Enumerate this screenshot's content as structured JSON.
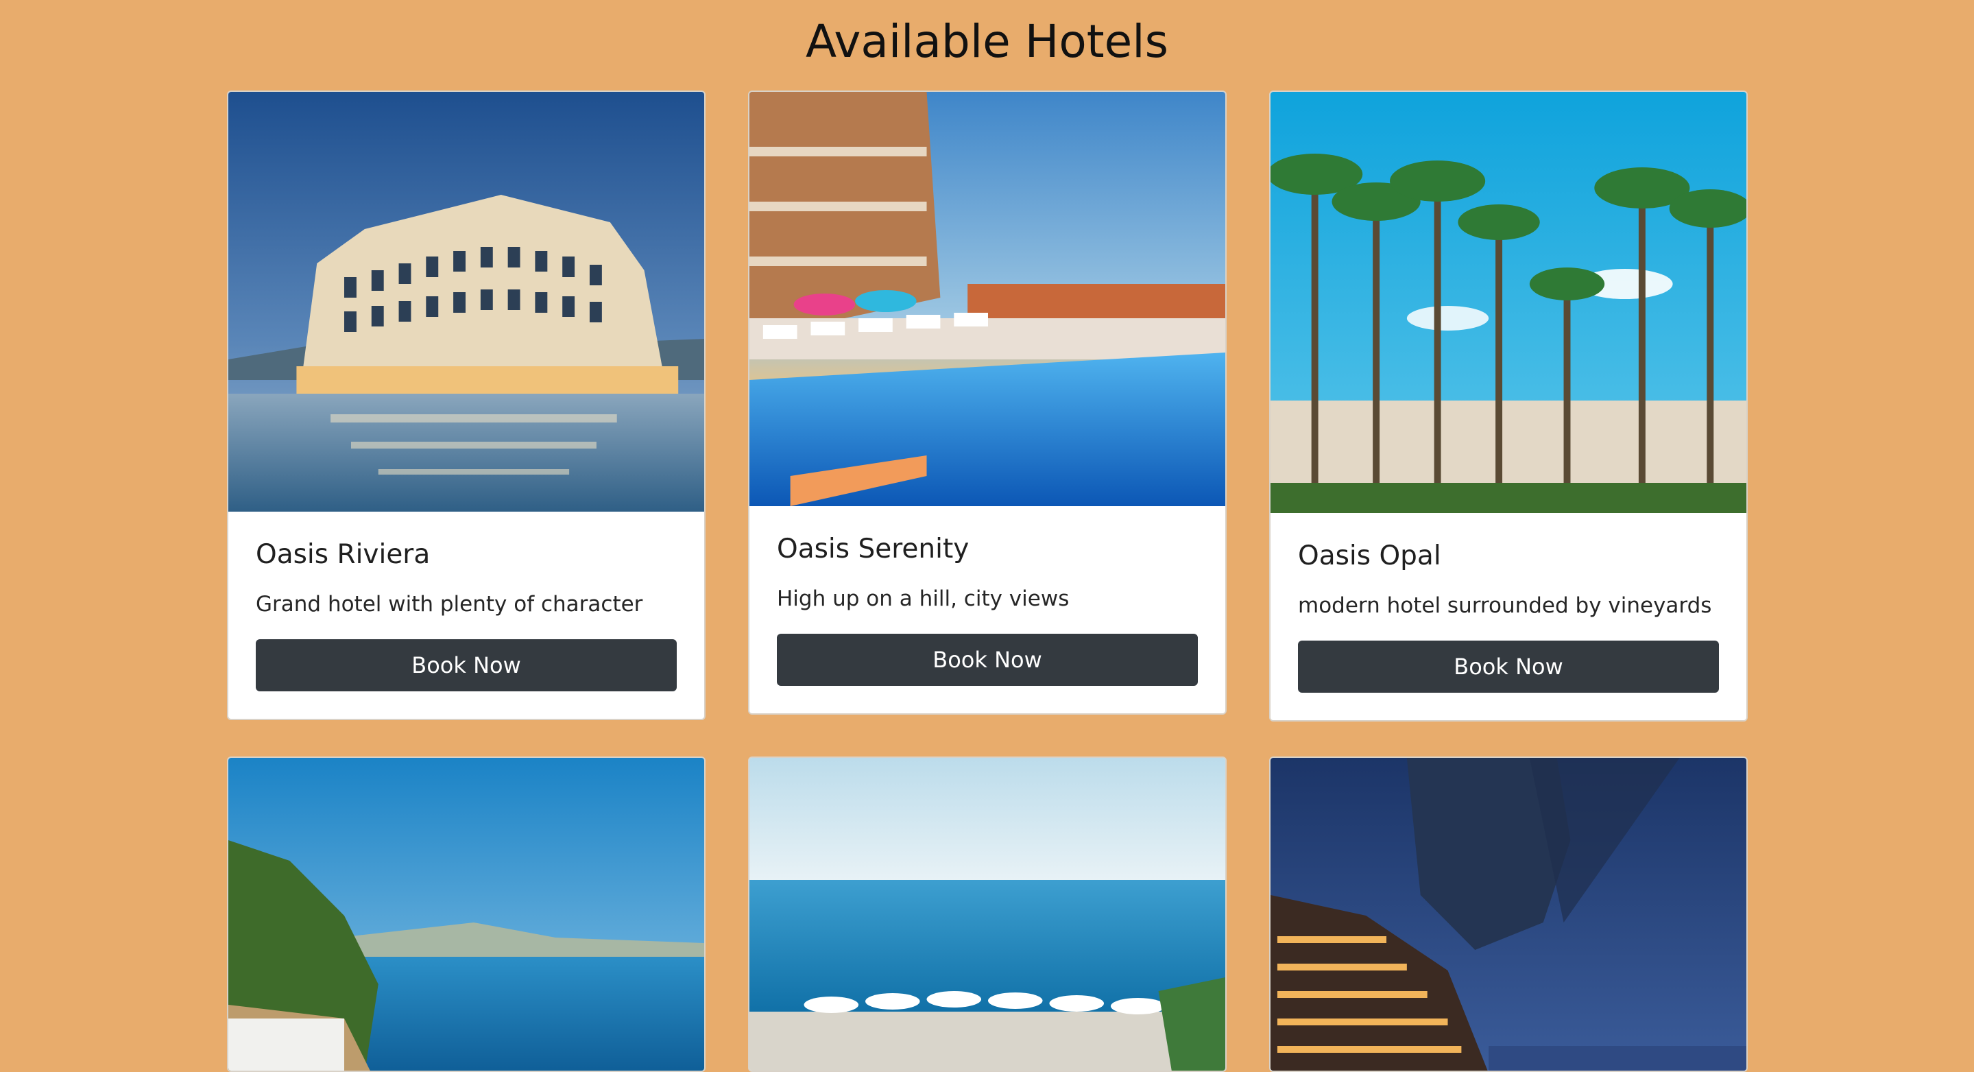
{
  "page": {
    "title": "Available Hotels"
  },
  "hotels": [
    {
      "name": "Oasis Riviera",
      "description": "Grand hotel with plenty of character",
      "button_label": "Book Now",
      "image_subject": "grand-palace-hotel-photo"
    },
    {
      "name": "Oasis Serenity",
      "description": "High up on a hill, city views",
      "button_label": "Book Now",
      "image_subject": "poolside-hotel-photo"
    },
    {
      "name": "Oasis Opal",
      "description": "modern hotel surrounded by vineyards",
      "button_label": "Book Now",
      "image_subject": "palm-tree-hotel-photo"
    },
    {
      "image_subject": "coastal-bay-photo"
    },
    {
      "image_subject": "seaside-terrace-photo"
    },
    {
      "image_subject": "cliffside-night-hotel-photo"
    }
  ],
  "colors": {
    "page_background": "#e8ac6c",
    "button_background": "#343a40",
    "button_text": "#ffffff",
    "card_background": "#ffffff"
  }
}
